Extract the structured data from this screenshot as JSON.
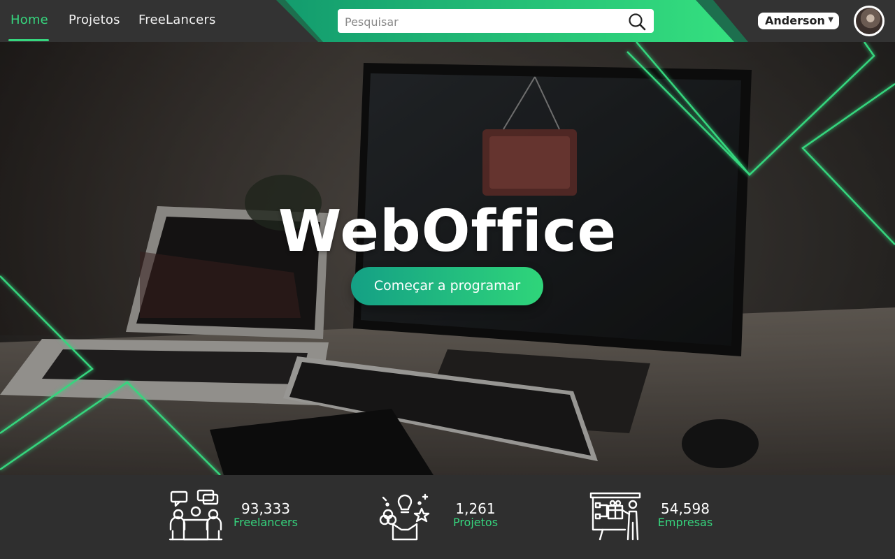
{
  "nav": {
    "items": [
      {
        "label": "Home",
        "active": true
      },
      {
        "label": "Projetos",
        "active": false
      },
      {
        "label": "FreeLancers",
        "active": false
      }
    ]
  },
  "search": {
    "placeholder": "Pesquisar",
    "value": "",
    "icon": "search-icon"
  },
  "user": {
    "name": "Anderson",
    "caret_icon": "caret-down-icon",
    "avatar_icon": "user-avatar"
  },
  "hero": {
    "title": "WebOffice",
    "cta_label": "Começar a programar"
  },
  "stats": [
    {
      "icon": "meeting-people-icon",
      "value": "93,333",
      "label": "Freelancers"
    },
    {
      "icon": "idea-box-icon",
      "value": "1,261",
      "label": "Projetos"
    },
    {
      "icon": "presentation-board-icon",
      "value": "54,598",
      "label": "Empresas"
    }
  ],
  "colors": {
    "accent": "#36d67e",
    "topbar": "#333333",
    "stats_bg": "#2f2f2f",
    "cta_start": "#14a085",
    "cta_end": "#2fd57a"
  }
}
